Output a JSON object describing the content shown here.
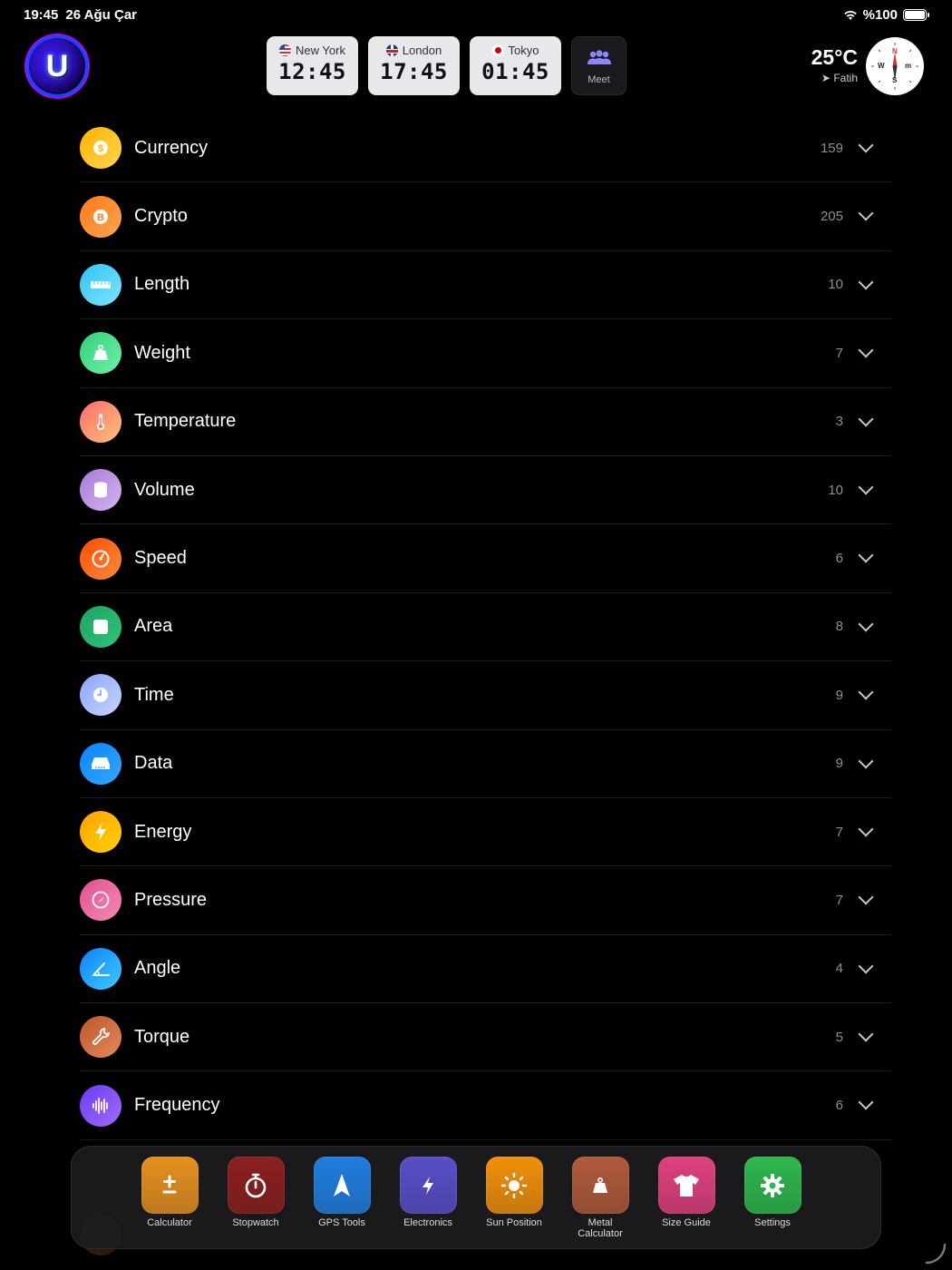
{
  "status_bar": {
    "time": "19:45",
    "date": "26 Ağu Çar",
    "battery": "%100"
  },
  "logo": {
    "letter": "U"
  },
  "world_clocks": [
    {
      "city": "New York",
      "time": "12:45",
      "flag": "us-flag"
    },
    {
      "city": "London",
      "time": "17:45",
      "flag": "uk-flag"
    },
    {
      "city": "Tokyo",
      "time": "01:45",
      "flag": "jp-flag"
    }
  ],
  "meet": {
    "label": "Meet"
  },
  "weather": {
    "temperature": "25°C",
    "location": "Fatih"
  },
  "compass": {
    "n": "N",
    "s": "S",
    "e": "m",
    "w": "W"
  },
  "categories": [
    {
      "label": "Currency",
      "count": "159",
      "icon": "dollar-icon",
      "color1": "#ffb300",
      "color2": "#ffd54f"
    },
    {
      "label": "Crypto",
      "count": "205",
      "icon": "bitcoin-icon",
      "color1": "#ff7a1a",
      "color2": "#ffa64d"
    },
    {
      "label": "Length",
      "count": "10",
      "icon": "ruler-icon",
      "color1": "#2ec5f5",
      "color2": "#7fe3ff"
    },
    {
      "label": "Weight",
      "count": "7",
      "icon": "weight-icon",
      "color1": "#2fd17a",
      "color2": "#6ff0a8"
    },
    {
      "label": "Temperature",
      "count": "3",
      "icon": "thermometer-icon",
      "color1": "#ff6b6b",
      "color2": "#ffc27a"
    },
    {
      "label": "Volume",
      "count": "10",
      "icon": "cylinder-icon",
      "color1": "#a77ad8",
      "color2": "#d4b5f2"
    },
    {
      "label": "Speed",
      "count": "6",
      "icon": "speedometer-icon",
      "color1": "#ff4d00",
      "color2": "#ff8a3d"
    },
    {
      "label": "Area",
      "count": "8",
      "icon": "square-icon",
      "color1": "#1fa363",
      "color2": "#2fc37a"
    },
    {
      "label": "Time",
      "count": "9",
      "icon": "clock-icon",
      "color1": "#8aa5ff",
      "color2": "#c7d4ff"
    },
    {
      "label": "Data",
      "count": "9",
      "icon": "drive-icon",
      "color1": "#0a84ff",
      "color2": "#33a8ff"
    },
    {
      "label": "Energy",
      "count": "7",
      "icon": "bolt-icon",
      "color1": "#ffa000",
      "color2": "#ffd400"
    },
    {
      "label": "Pressure",
      "count": "7",
      "icon": "gauge-icon",
      "color1": "#e0508f",
      "color2": "#f58bb5"
    },
    {
      "label": "Angle",
      "count": "4",
      "icon": "angle-icon",
      "color1": "#0a84ff",
      "color2": "#40c8ff"
    },
    {
      "label": "Torque",
      "count": "5",
      "icon": "wrench-icon",
      "color1": "#c0562a",
      "color2": "#e08a5a"
    },
    {
      "label": "Frequency",
      "count": "6",
      "icon": "waveform-icon",
      "color1": "#6a3cf0",
      "color2": "#a06cff"
    }
  ],
  "dock": [
    {
      "label": "Calculator",
      "icon": "plus-minus-icon",
      "color": "#e5901e"
    },
    {
      "label": "Stopwatch",
      "icon": "stopwatch-icon",
      "color": "#8c1f1f"
    },
    {
      "label": "GPS Tools",
      "icon": "navigation-arrow-icon",
      "color": "#1f7ee0"
    },
    {
      "label": "Electronics",
      "icon": "bolt-icon",
      "color": "#5a4ec9"
    },
    {
      "label": "Sun Position",
      "icon": "sun-icon",
      "color": "#f0900a"
    },
    {
      "label": "Metal\nCalculator",
      "icon": "weight-icon",
      "color": "#b05a3a"
    },
    {
      "label": "Size Guide",
      "icon": "tshirt-icon",
      "color": "#e0407f"
    },
    {
      "label": "Settings",
      "icon": "gear-icon",
      "color": "#2eb84d"
    }
  ]
}
